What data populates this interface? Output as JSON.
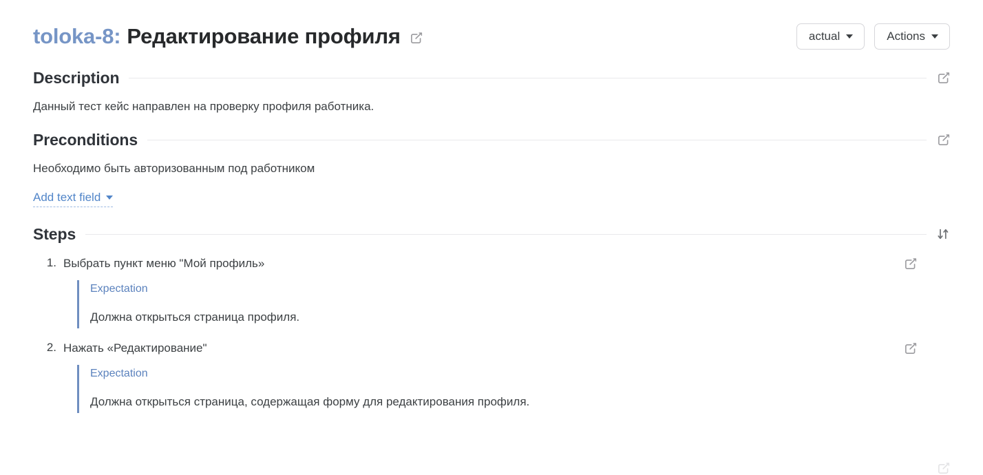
{
  "header": {
    "issue_key": "toloka-8:",
    "issue_title": "Редактирование профиля",
    "edit_icon": "edit-icon",
    "buttons": [
      {
        "label": "actual",
        "name": "actual-dropdown"
      },
      {
        "label": "Actions",
        "name": "actions-dropdown"
      }
    ]
  },
  "description": {
    "heading": "Description",
    "text": "Данный тест кейс направлен на проверку профиля работника.",
    "edit_icon": "edit-icon"
  },
  "preconditions": {
    "heading": "Preconditions",
    "text": "Необходимо быть авторизованным под работником",
    "edit_icon": "edit-icon",
    "add_field_label": "Add text field"
  },
  "steps": {
    "heading": "Steps",
    "sort_icon": "sort-arrows-icon",
    "items": [
      {
        "number": "1.",
        "text": "Выбрать пункт меню \"Мой профиль»",
        "expectation_label": "Expectation",
        "expectation_text": "Должна открыться страница профиля.",
        "edit_icon": "edit-icon"
      },
      {
        "number": "2.",
        "text": "Нажать «Редактирование\"",
        "expectation_label": "Expectation",
        "expectation_text": "Должна открыться страница, содержащая форму для редактирования профиля.",
        "edit_icon": "edit-icon"
      }
    ]
  },
  "colors": {
    "issue_key_blue": "#7695c6",
    "link_blue": "#5286c9",
    "expectation_blue": "#5b82bd",
    "expectation_bar": "#6f8ec0",
    "rule_gray": "#e9e9ec",
    "text": "#3c4043"
  }
}
